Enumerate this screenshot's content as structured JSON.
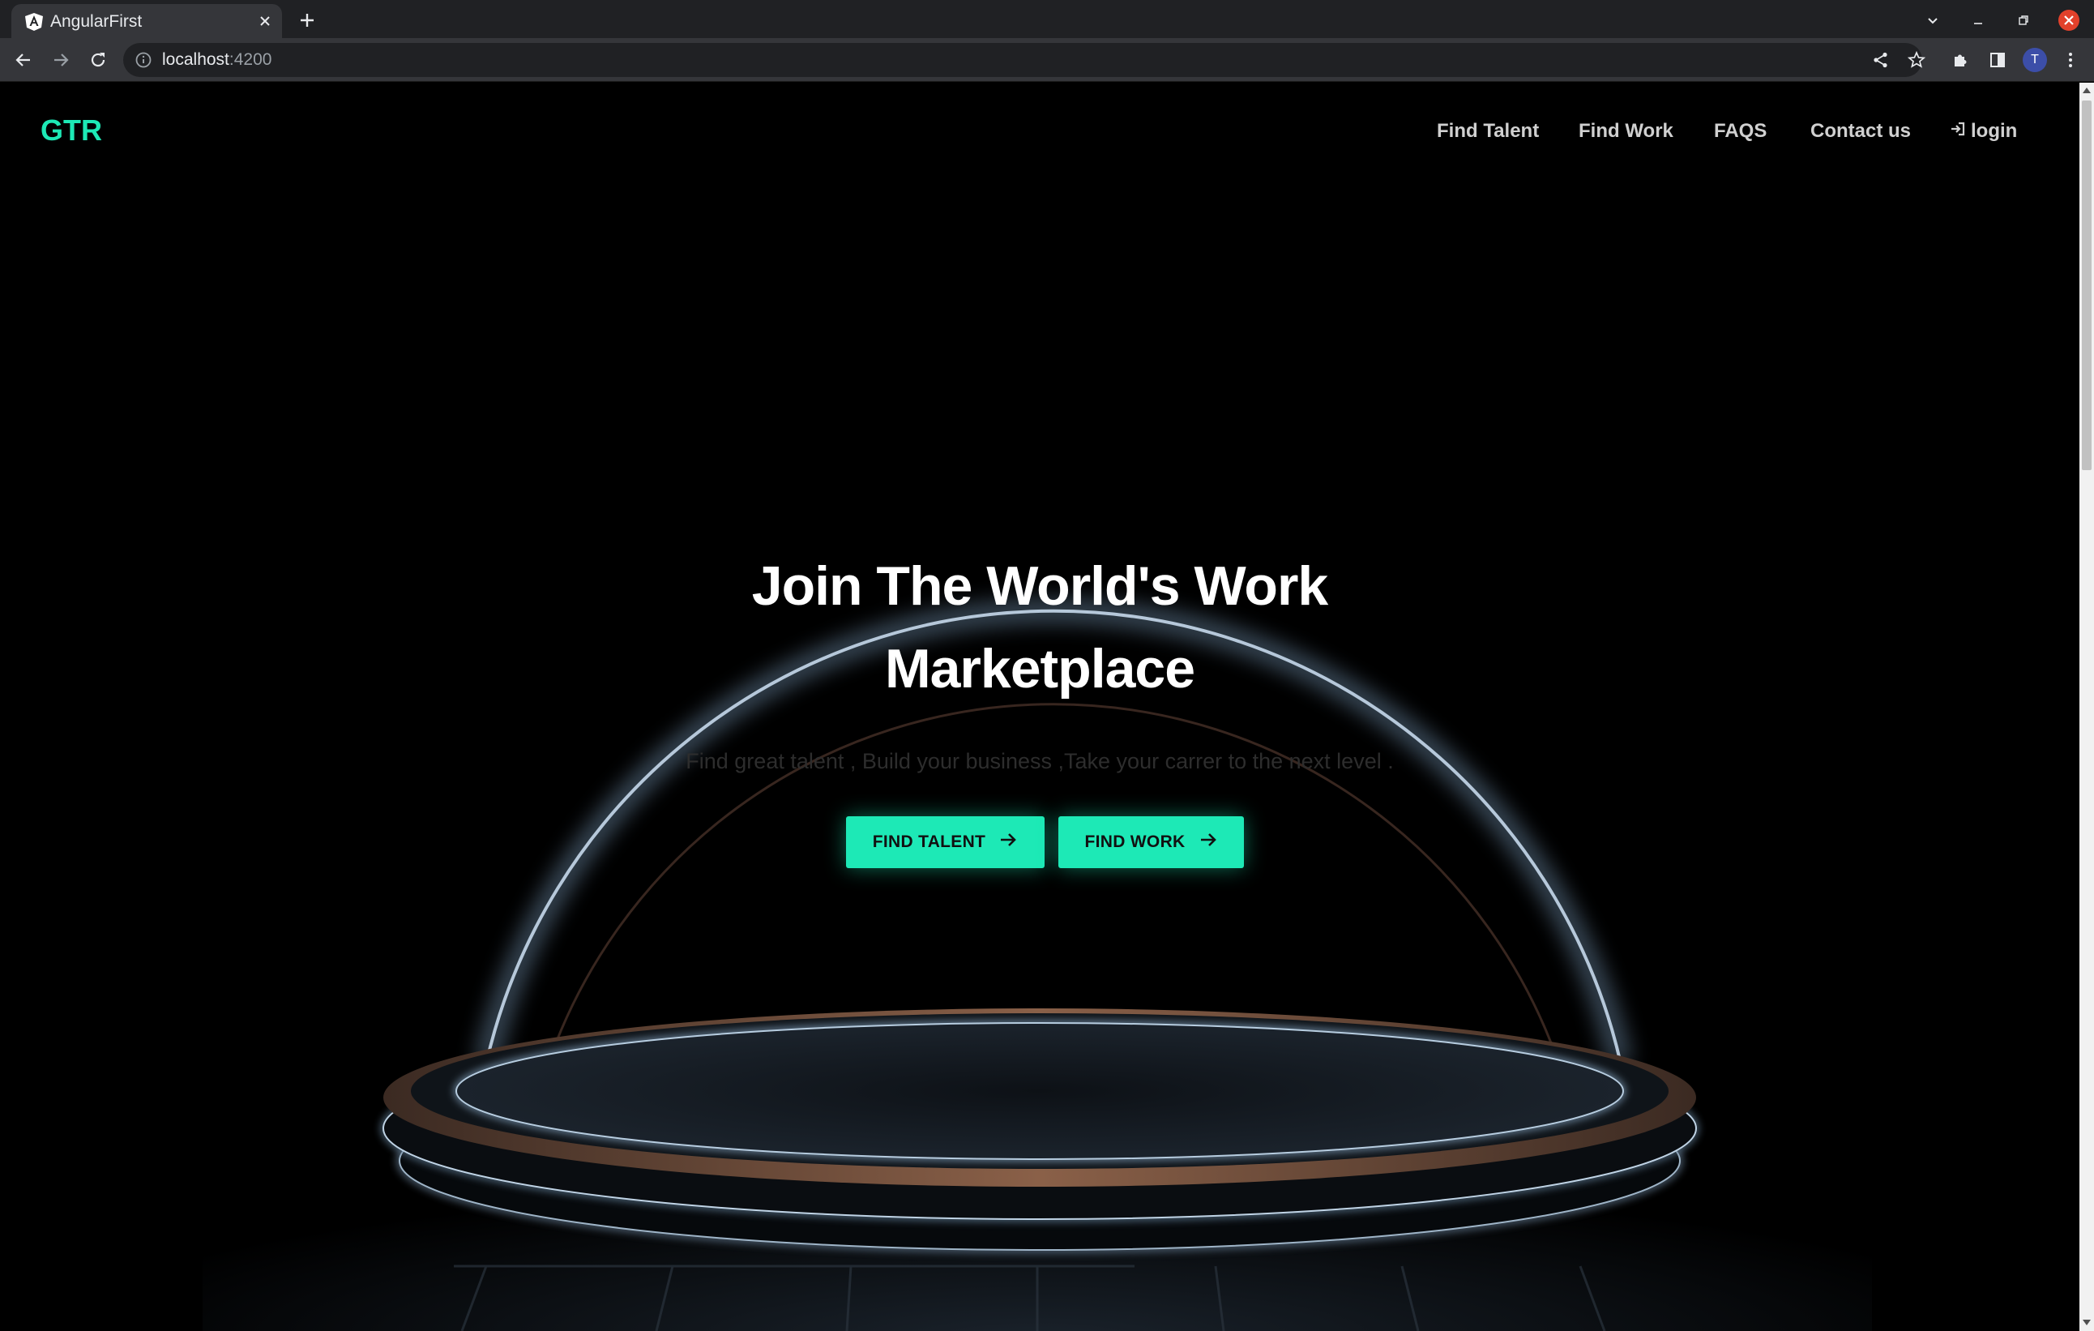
{
  "browser": {
    "tab_title": "AngularFirst",
    "url_host": "localhost",
    "url_port": ":4200",
    "profile_initial": "T"
  },
  "site": {
    "brand": "GTR",
    "nav": {
      "find_talent": "Find Talent",
      "find_work": "Find Work",
      "faqs": "FAQS",
      "contact": "Contact us",
      "login": "login"
    }
  },
  "hero": {
    "title_line1": "Join The World's Work",
    "title_line2": "Marketplace",
    "subtitle": "Find great talent , Build your business ,Take your carrer to the next level .",
    "cta_talent": "FIND TALENT",
    "cta_work": "FIND WORK"
  },
  "colors": {
    "accent": "#1de9b6",
    "background": "#000000",
    "chrome_dark": "#202124",
    "chrome_toolbar": "#35363a",
    "close_red": "#e2412b"
  },
  "icons": {
    "tab_favicon": "angular-icon",
    "nav_login": "sign-in-icon",
    "cta_arrow": "arrow-right-icon"
  }
}
